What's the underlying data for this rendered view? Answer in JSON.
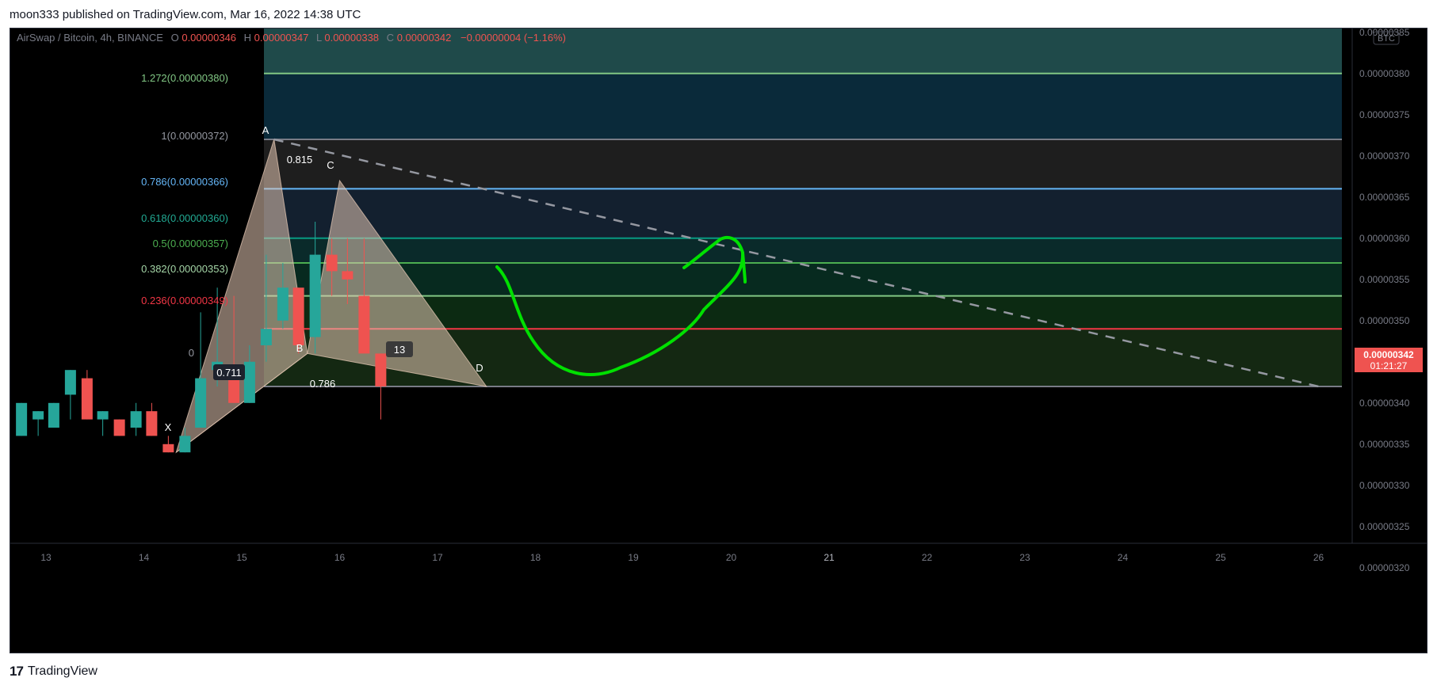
{
  "header": {
    "published": "moon333 published on TradingView.com, Mar 16, 2022 14:38 UTC"
  },
  "footer": {
    "brand": "TradingView",
    "brand_mark": "17"
  },
  "legend": {
    "symbol": "AirSwap / Bitcoin, 4h, BINANCE",
    "o_label": "O",
    "o_value": "0.00000346",
    "h_label": "H",
    "h_value": "0.00000347",
    "l_label": "L",
    "l_value": "0.00000338",
    "c_label": "C",
    "c_value": "0.00000342",
    "change": "−0.00000004 (−1.16%)"
  },
  "price_axis": {
    "currency_badge": "BTC",
    "last_price": "0.00000342",
    "countdown": "01:21:27"
  },
  "fib_labels": {
    "f1272": "1.272(0.00000380)",
    "f1": "1(0.00000372)",
    "f0786": "0.786(0.00000366)",
    "f0618": "0.618(0.00000360)",
    "f05": "0.5(0.00000357)",
    "f0382": "0.382(0.00000353)",
    "f0236": "0.236(0.00000349)",
    "f0": "0"
  },
  "pattern_labels": {
    "X": "X",
    "A": "A",
    "B": "B",
    "C": "C",
    "D": "D",
    "r_xb": "0.711",
    "r_ac": "0.786",
    "r_bc": "0.815",
    "count": "13"
  },
  "colors": {
    "bull": "#26a69a",
    "bear": "#ef5350",
    "background": "#000000",
    "fib_1272": "#81c784",
    "fib_1": "#787b86",
    "fib_0786": "#64b5f6",
    "fib_0618": "#089981",
    "fib_05": "#4caf50",
    "fib_0382": "#81c784",
    "fib_0236": "#f23645",
    "fib_0": "#787b86",
    "drawing": "#00e000"
  },
  "chart_data": {
    "type": "candlestick",
    "title": "AirSwap / Bitcoin, 4h, BINANCE",
    "ylim": [
      3.16e-06,
      3.88e-06
    ],
    "y_ticks": [
      "0.00000320",
      "0.00000325",
      "0.00000330",
      "0.00000335",
      "0.00000340",
      "0.00000345",
      "0.00000350",
      "0.00000355",
      "0.00000360",
      "0.00000365",
      "0.00000370",
      "0.00000375",
      "0.00000380",
      "0.00000385"
    ],
    "x_ticks": [
      "13",
      "14",
      "15",
      "16",
      "17",
      "18",
      "19",
      "20",
      "21",
      "22",
      "23",
      "24",
      "25",
      "26"
    ],
    "candles": [
      {
        "d": 12.75,
        "o": 3.36,
        "h": 3.4,
        "l": 3.36,
        "c": 3.4
      },
      {
        "d": 12.92,
        "o": 3.38,
        "h": 3.39,
        "l": 3.36,
        "c": 3.39
      },
      {
        "d": 13.08,
        "o": 3.37,
        "h": 3.4,
        "l": 3.37,
        "c": 3.4
      },
      {
        "d": 13.25,
        "o": 3.41,
        "h": 3.44,
        "l": 3.38,
        "c": 3.44
      },
      {
        "d": 13.42,
        "o": 3.43,
        "h": 3.44,
        "l": 3.38,
        "c": 3.38
      },
      {
        "d": 13.58,
        "o": 3.38,
        "h": 3.39,
        "l": 3.36,
        "c": 3.39
      },
      {
        "d": 13.75,
        "o": 3.38,
        "h": 3.38,
        "l": 3.36,
        "c": 3.36
      },
      {
        "d": 13.92,
        "o": 3.37,
        "h": 3.4,
        "l": 3.36,
        "c": 3.39
      },
      {
        "d": 14.08,
        "o": 3.39,
        "h": 3.4,
        "l": 3.36,
        "c": 3.36
      },
      {
        "d": 14.25,
        "o": 3.35,
        "h": 3.36,
        "l": 3.34,
        "c": 3.34
      },
      {
        "d": 14.42,
        "o": 3.34,
        "h": 3.37,
        "l": 3.34,
        "c": 3.36
      },
      {
        "d": 14.58,
        "o": 3.37,
        "h": 3.51,
        "l": 3.37,
        "c": 3.43
      },
      {
        "d": 14.75,
        "o": 3.44,
        "h": 3.54,
        "l": 3.42,
        "c": 3.45
      },
      {
        "d": 14.92,
        "o": 3.43,
        "h": 3.53,
        "l": 3.4,
        "c": 3.4
      },
      {
        "d": 15.08,
        "o": 3.4,
        "h": 3.47,
        "l": 3.4,
        "c": 3.45
      },
      {
        "d": 15.25,
        "o": 3.47,
        "h": 3.58,
        "l": 3.45,
        "c": 3.49
      },
      {
        "d": 15.42,
        "o": 3.5,
        "h": 3.57,
        "l": 3.49,
        "c": 3.54
      },
      {
        "d": 15.58,
        "o": 3.54,
        "h": 3.54,
        "l": 3.46,
        "c": 3.47
      },
      {
        "d": 15.75,
        "o": 3.48,
        "h": 3.62,
        "l": 3.46,
        "c": 3.58
      },
      {
        "d": 15.92,
        "o": 3.58,
        "h": 3.6,
        "l": 3.53,
        "c": 3.56
      },
      {
        "d": 16.08,
        "o": 3.56,
        "h": 3.6,
        "l": 3.52,
        "c": 3.55
      },
      {
        "d": 16.25,
        "o": 3.53,
        "h": 3.6,
        "l": 3.49,
        "c": 3.46
      },
      {
        "d": 16.42,
        "o": 3.46,
        "h": 3.46,
        "l": 3.38,
        "c": 3.42
      }
    ],
    "fib_levels": [
      {
        "ratio": "1.272",
        "price": 3.8
      },
      {
        "ratio": "1",
        "price": 3.72
      },
      {
        "ratio": "0.786",
        "price": 3.66
      },
      {
        "ratio": "0.618",
        "price": 3.6
      },
      {
        "ratio": "0.5",
        "price": 3.57
      },
      {
        "ratio": "0.382",
        "price": 3.53
      },
      {
        "ratio": "0.236",
        "price": 3.49
      },
      {
        "ratio": "0",
        "price": 3.42
      }
    ],
    "harmonic_points": [
      {
        "label": "X",
        "d": 14.33,
        "p": 3.34
      },
      {
        "label": "A",
        "d": 15.33,
        "p": 3.72
      },
      {
        "label": "B",
        "d": 15.67,
        "p": 3.46
      },
      {
        "label": "C",
        "d": 16.0,
        "p": 3.67
      },
      {
        "label": "D",
        "d": 17.5,
        "p": 3.42
      }
    ],
    "trendline": {
      "from": {
        "d": 15.33,
        "p": 3.72
      },
      "to": {
        "d": 26.0,
        "p": 3.42
      }
    }
  }
}
